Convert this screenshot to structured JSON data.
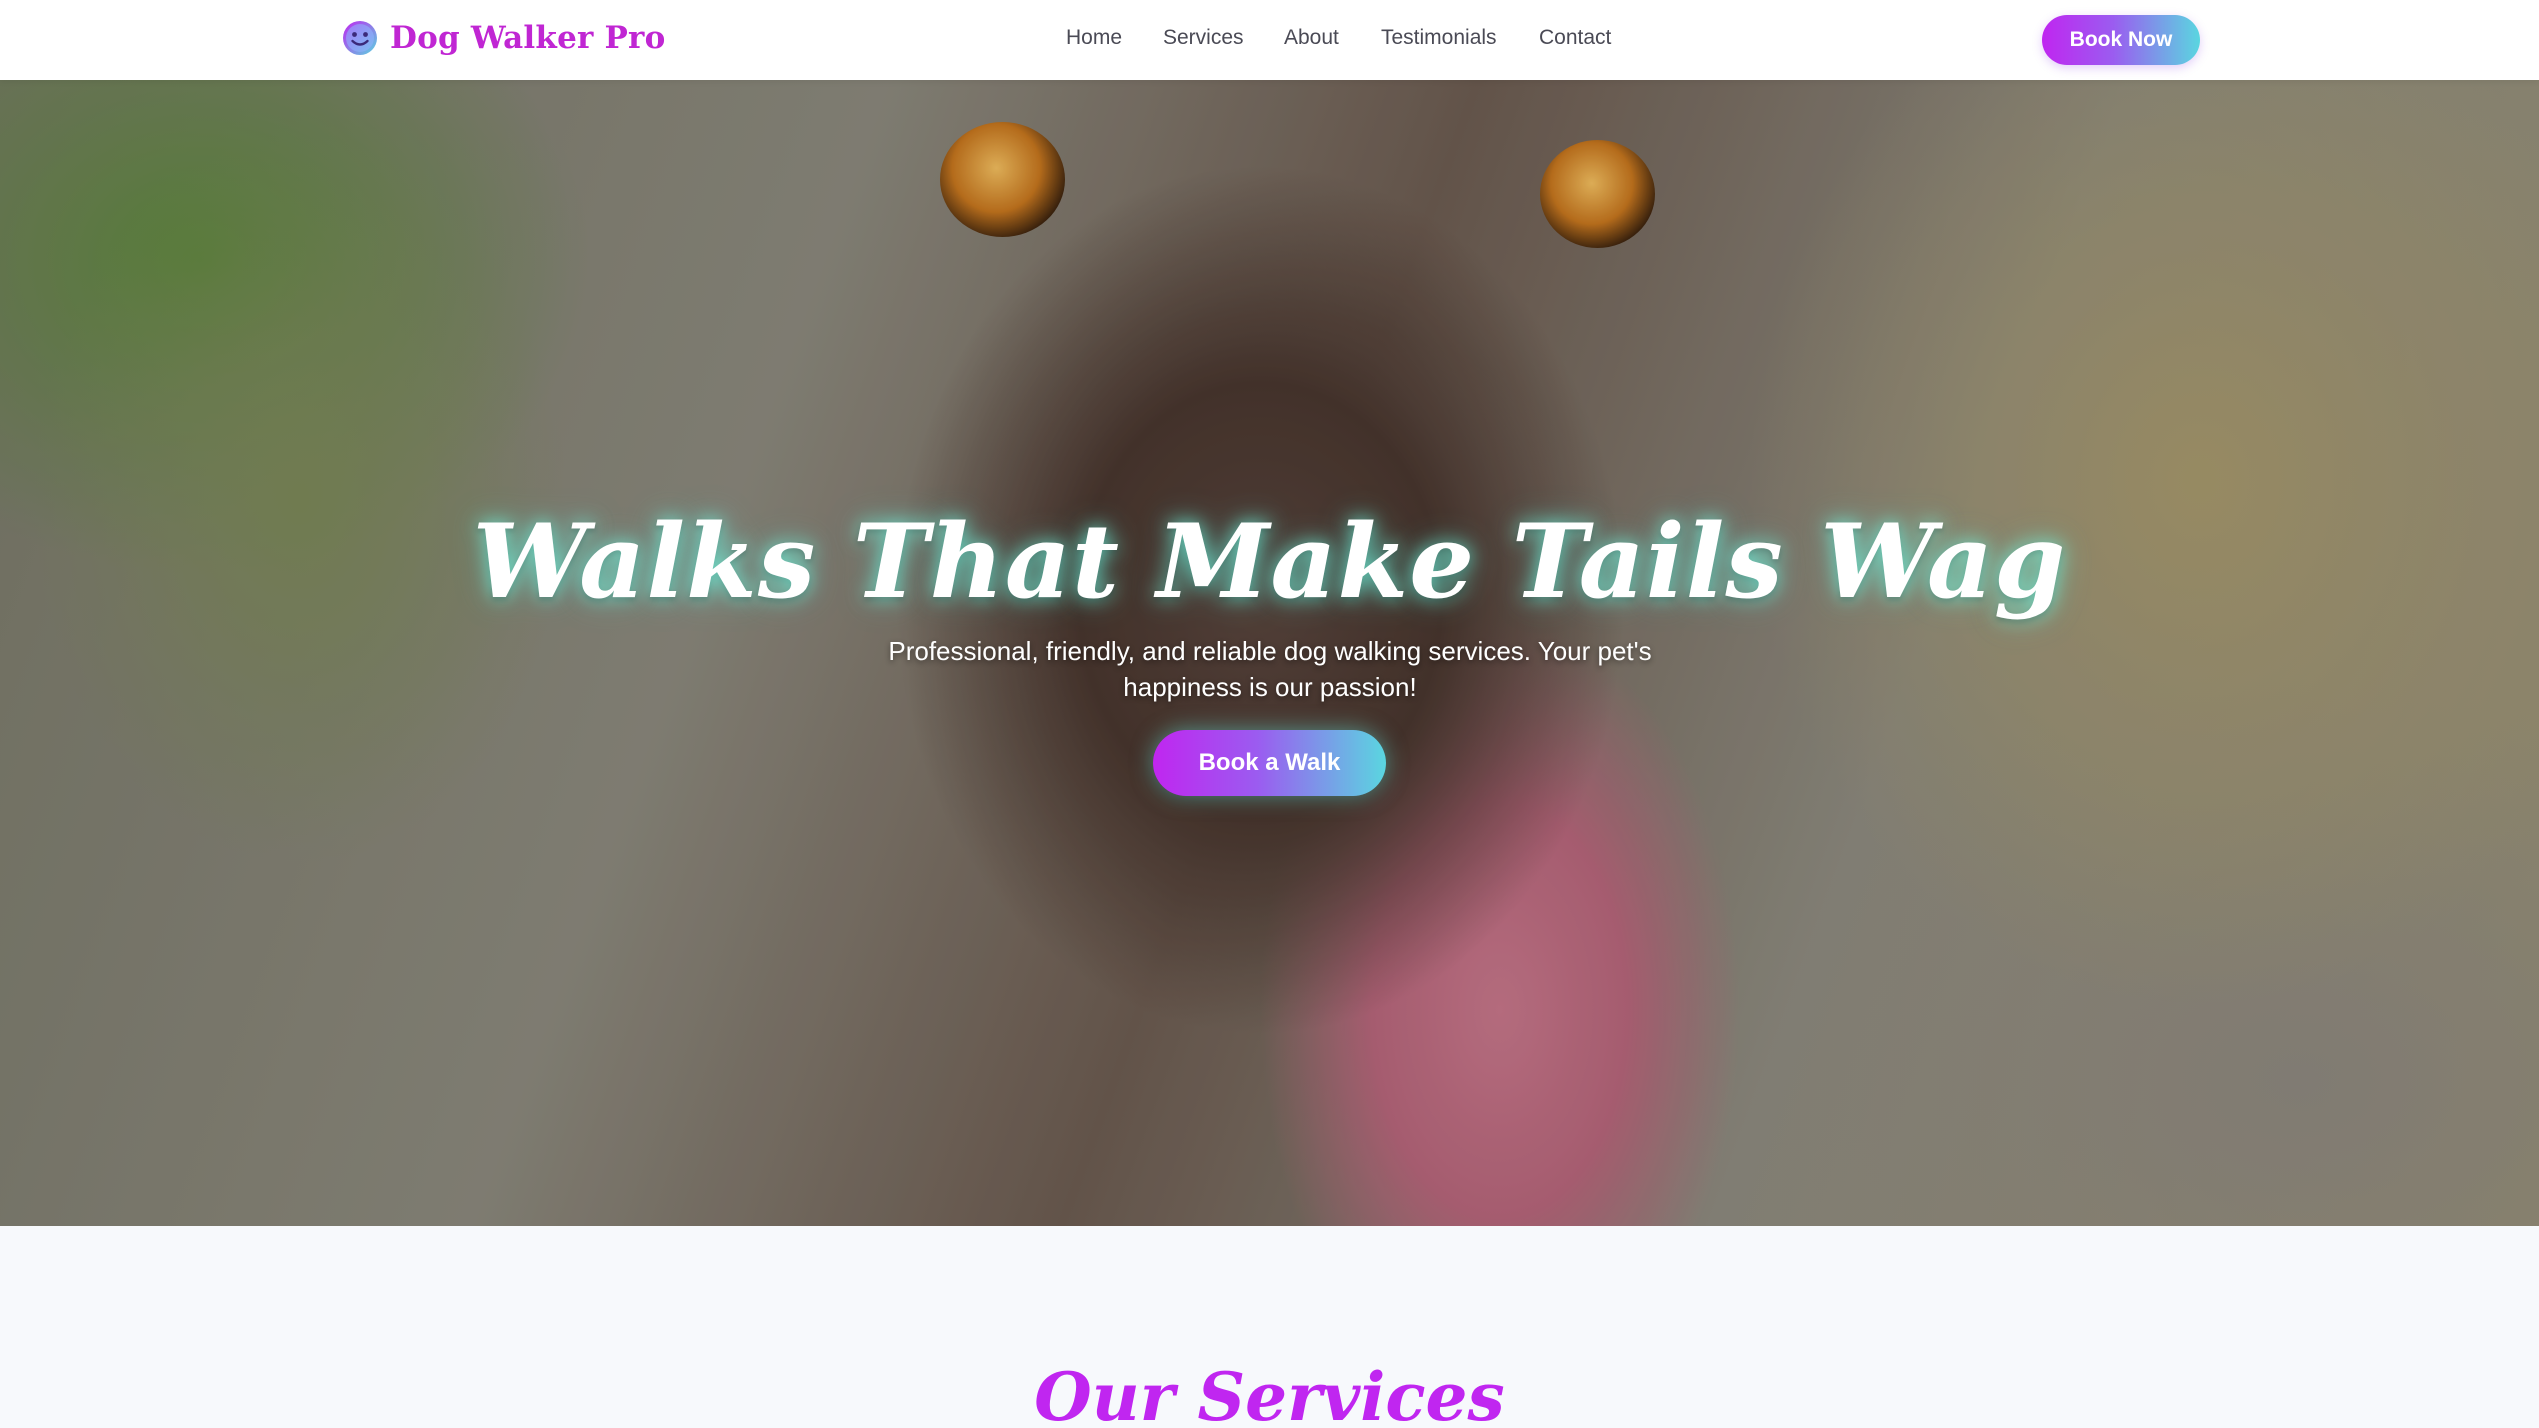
{
  "brand": {
    "name": "Dog Walker Pro",
    "icon": "smiley-face-icon"
  },
  "nav": {
    "items": [
      {
        "label": "Home"
      },
      {
        "label": "Services"
      },
      {
        "label": "About"
      },
      {
        "label": "Testimonials"
      },
      {
        "label": "Contact"
      }
    ],
    "cta_label": "Book Now"
  },
  "hero": {
    "title": "Walks That Make Tails Wag",
    "subtitle": "Professional, friendly, and reliable dog walking services. Your pet's happiness is our passion!",
    "cta_label": "Book a Walk",
    "background_image": "dog-licking-nose-photo"
  },
  "services": {
    "title": "Our Services"
  },
  "colors": {
    "brand": "#c026d3",
    "gradient_start": "#c026f0",
    "gradient_end": "#5ad6e0",
    "nav_text": "#4a4a55",
    "section_bg": "#f7f9fc"
  }
}
